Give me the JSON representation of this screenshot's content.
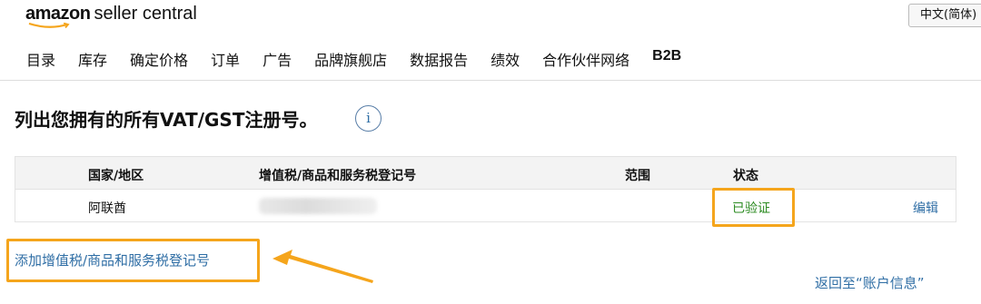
{
  "header": {
    "logo_brand": "amazon",
    "logo_suffix": "seller central",
    "language_selected": "中文(简体)"
  },
  "nav": {
    "items": [
      "目录",
      "库存",
      "确定价格",
      "订单",
      "广告",
      "品牌旗舰店",
      "数据报告",
      "绩效",
      "合作伙伴网络",
      "B2B"
    ]
  },
  "page": {
    "title": "列出您拥有的所有VAT/GST注册号。",
    "info_icon": "i"
  },
  "table": {
    "headers": {
      "country": "国家/地区",
      "vat_number": "增值税/商品和服务税登记号",
      "scope": "范围",
      "status": "状态"
    },
    "rows": [
      {
        "country": "阿联酋",
        "vat_number": "",
        "scope": "",
        "status": "已验证",
        "action": "编辑"
      }
    ]
  },
  "links": {
    "add_registration": "添加增值税/商品和服务税登记号",
    "back_to_account": "返回至“账户信息”"
  },
  "colors": {
    "link": "#2f6ea5",
    "verified": "#2a8a1f",
    "highlight": "#f5a51c",
    "header_bg": "#f3f3f3"
  }
}
